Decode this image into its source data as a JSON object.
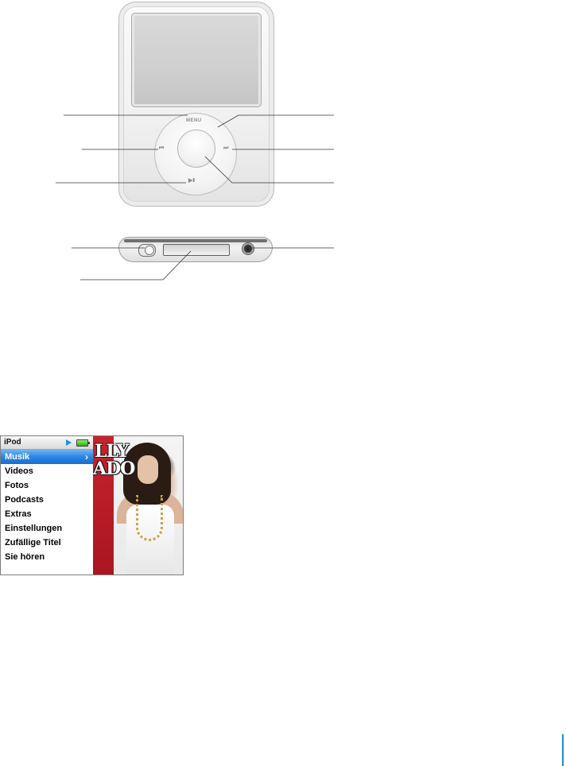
{
  "diagram": {
    "click_wheel": {
      "menu_label": "MENU",
      "previous_glyph": "⏮",
      "next_glyph": "⏭",
      "play_pause_glyph": "▶ II"
    }
  },
  "screen": {
    "title": "iPod",
    "menu_items": [
      {
        "label": "Musik",
        "selected": true,
        "chevron": "›"
      },
      {
        "label": "Videos",
        "selected": false
      },
      {
        "label": "Fotos",
        "selected": false
      },
      {
        "label": "Podcasts",
        "selected": false
      },
      {
        "label": "Extras",
        "selected": false
      },
      {
        "label": "Einstellungen",
        "selected": false
      },
      {
        "label": "Zufällige Titel",
        "selected": false
      },
      {
        "label": "Sie hören",
        "selected": false
      }
    ],
    "album_art_text": [
      "LLY",
      "ADO"
    ],
    "colors": {
      "selection": "#2c86e2",
      "play_indicator": "#1d8ee6",
      "battery": "#27b015",
      "art_red": "#c7232c"
    }
  },
  "page_marker_color": "#1b8fc9"
}
